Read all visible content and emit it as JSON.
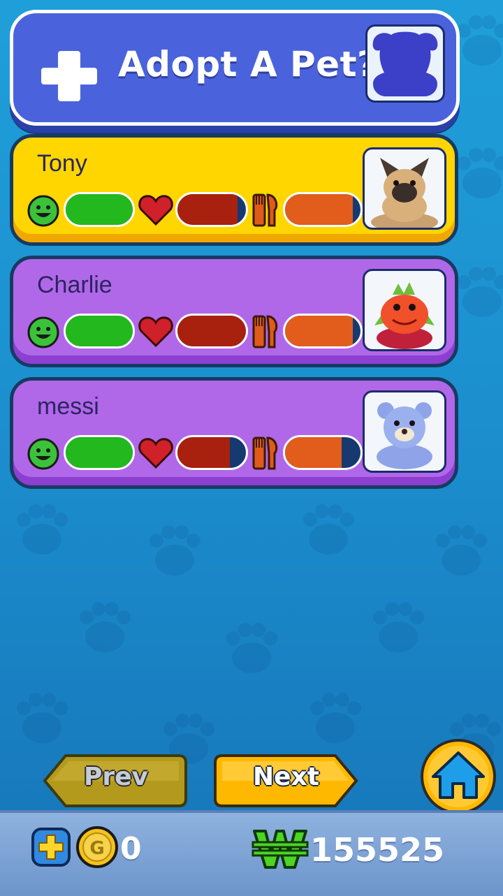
{
  "header": {
    "title": "Adopt A Pet?"
  },
  "pets": [
    {
      "name": "Tony",
      "happiness": 1.0,
      "health": 0.88,
      "hunger": 0.9,
      "card_color": "#ffd600"
    },
    {
      "name": "Charlie",
      "happiness": 1.0,
      "health": 1.0,
      "hunger": 0.9,
      "card_color": "#b068e8"
    },
    {
      "name": "messi",
      "happiness": 1.0,
      "health": 0.77,
      "hunger": 0.75,
      "card_color": "#b068e8"
    }
  ],
  "nav": {
    "prev_label": "Prev",
    "next_label": "Next"
  },
  "currency": {
    "gems": "0",
    "kinzcash": "155525"
  },
  "colors": {
    "happy": "#22b81e",
    "health": "#a8200e",
    "hunger": "#e25c1c"
  }
}
